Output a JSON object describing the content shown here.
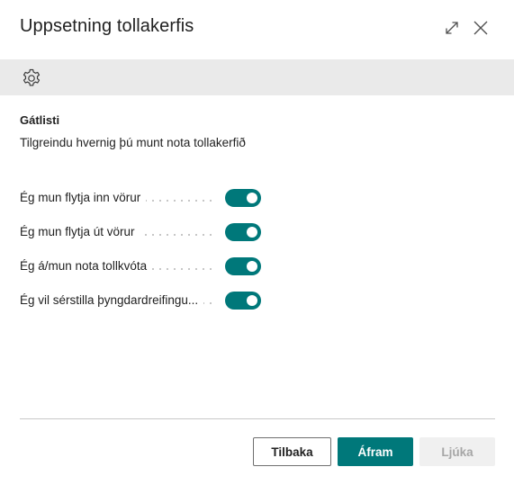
{
  "dialog": {
    "title": "Uppsetning tollakerfis",
    "header_icons": [
      "expand-icon",
      "close-icon"
    ]
  },
  "toolbar": {
    "icons": [
      "gear-icon"
    ]
  },
  "content": {
    "section_title": "Gátlisti",
    "description": "Tilgreindu hvernig þú munt nota tollakerfið",
    "options": [
      {
        "label": "Ég mun flytja inn vörur",
        "enabled": true
      },
      {
        "label": "Ég mun flytja út vörur",
        "enabled": true
      },
      {
        "label": "Ég á/mun nota tollkvóta",
        "enabled": true
      },
      {
        "label": "Ég vil sérstilla þyngdardreifingu...",
        "enabled": true
      }
    ]
  },
  "footer": {
    "back_label": "Tilbaka",
    "next_label": "Áfram",
    "finish_label": "Ljúka",
    "finish_disabled": true
  },
  "colors": {
    "accent": "#00787a",
    "toolbar_bg": "#eaeaea",
    "divider": "#c8c8c8"
  }
}
